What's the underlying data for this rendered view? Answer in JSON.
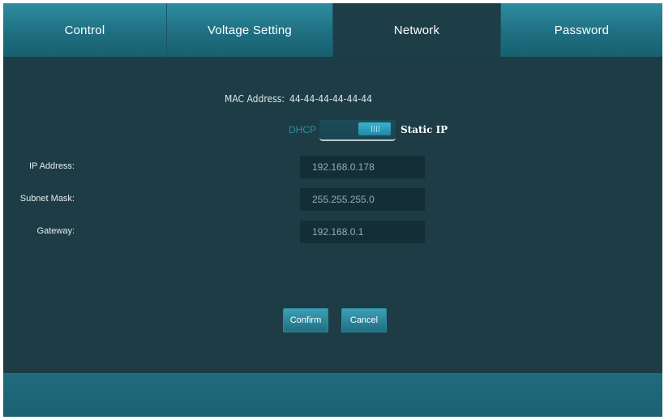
{
  "tabs": [
    {
      "label": "Control"
    },
    {
      "label": "Voltage Setting"
    },
    {
      "label": "Network"
    },
    {
      "label": "Password"
    }
  ],
  "active_tab": "Network",
  "network": {
    "mac_label": "MAC Address:",
    "mac_value": "44-44-44-44-44-44",
    "mode_left_label": "DHCP",
    "mode_right_label": "Static IP",
    "mode_selected": "Static IP",
    "fields": [
      {
        "label": "IP Address:",
        "value": "192.168.0.178"
      },
      {
        "label": "Subnet Mask:",
        "value": "255.255.255.0"
      },
      {
        "label": "Gateway:",
        "value": "192.168.0.1"
      }
    ],
    "confirm_label": "Confirm",
    "cancel_label": "Cancel"
  },
  "colors": {
    "background": "#1e3c45",
    "tab_gradient_top": "#2e8ca0",
    "tab_active": "#1d3e47",
    "dhcp_inactive": "#2c8fa4",
    "input_bg": "#142e35"
  }
}
